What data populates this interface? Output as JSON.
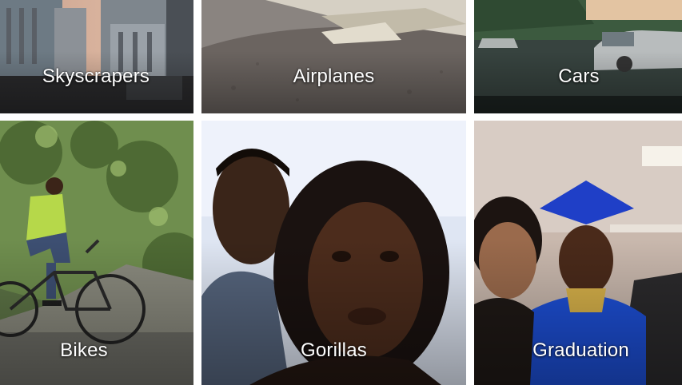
{
  "albums": [
    {
      "label": "Skyscrapers"
    },
    {
      "label": "Airplanes"
    },
    {
      "label": "Cars"
    },
    {
      "label": "Bikes"
    },
    {
      "label": "Gorillas"
    },
    {
      "label": "Graduation"
    }
  ]
}
